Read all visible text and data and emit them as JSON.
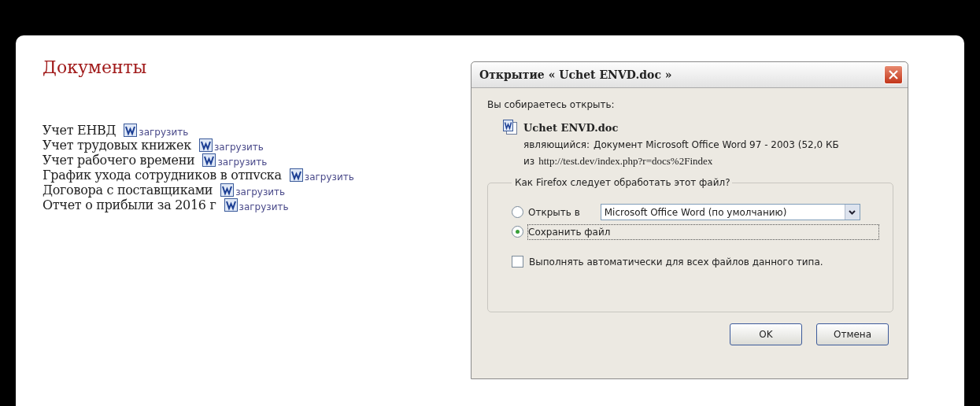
{
  "page": {
    "title": "Документы",
    "documents": [
      {
        "name": "Учет ЕНВД",
        "link": "загрузить"
      },
      {
        "name": "Учет трудовых книжек",
        "link": "загрузить"
      },
      {
        "name": "Учет рабочего времени",
        "link": "загрузить"
      },
      {
        "name": "График ухода сотрудников в отпvcка",
        "link": "загрузить"
      },
      {
        "name": "Договора с поставщиками",
        "link": "загрузить"
      },
      {
        "name": "Отчет о прибыли за 2016 г",
        "link": "загрузить"
      }
    ]
  },
  "dialog": {
    "title": "Открытие « Uchet ENVD.doc »",
    "intro": "Вы собираетесь открыть:",
    "file_name": "Uchet ENVD.doc",
    "type_label": "являющийся:",
    "type_value": "Документ Microsoft Office Word 97 - 2003 (52,0 КБ",
    "from_label": "из",
    "from_value": "http://test.dev/index.php?r=docs%2Findex",
    "group_title": "Как Firefox следует обработать этот файл?",
    "options": [
      {
        "kind": "open",
        "label": "Открыть в",
        "selected": false,
        "app": "Microsoft Office Word (по умолчанию)"
      },
      {
        "kind": "save",
        "label": "Сохранить файл",
        "selected": true
      }
    ],
    "auto": {
      "label": "Выполнять автоматически для всех файлов данного типа.",
      "checked": false
    },
    "buttons": [
      "OK",
      "Отмена"
    ]
  }
}
